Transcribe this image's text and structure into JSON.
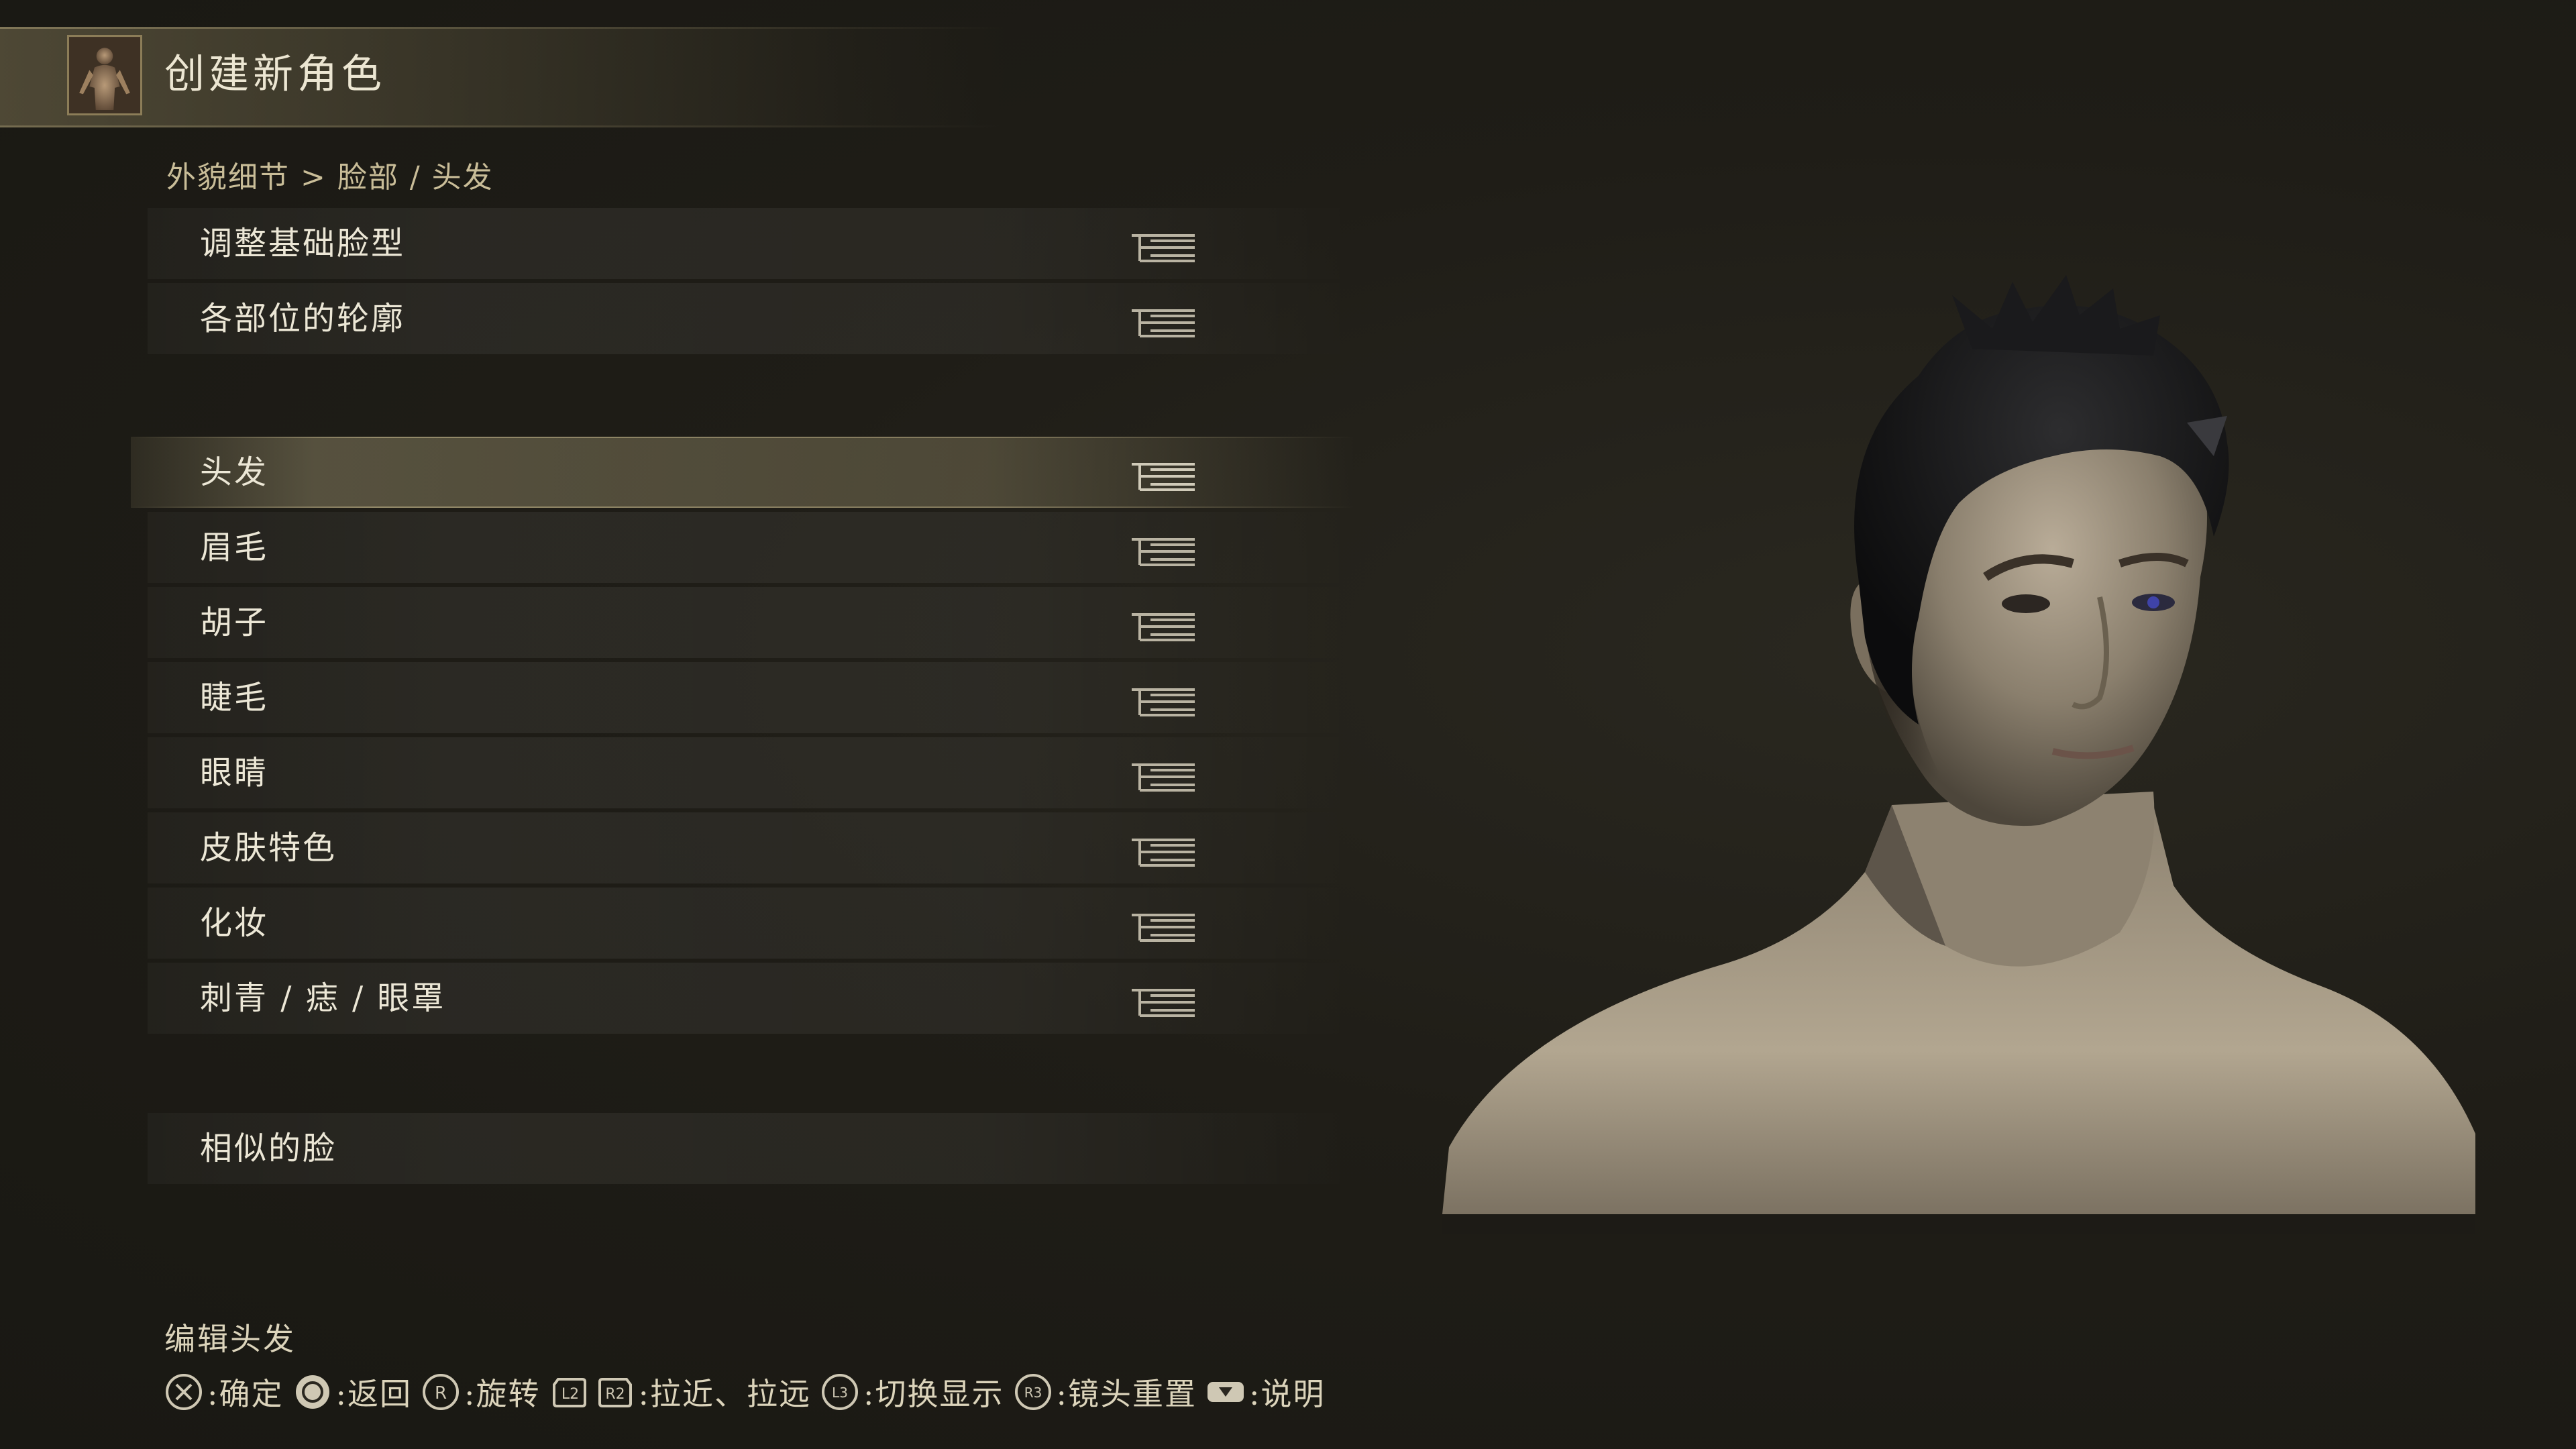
{
  "header": {
    "title": "创建新角色",
    "portrait_icon": "character-body-portrait"
  },
  "breadcrumb": "外貌细节 > 脸部 / 头发",
  "menu": {
    "items": [
      {
        "label": "调整基础脸型",
        "has_submenu": true,
        "selected": false
      },
      {
        "label": "各部位的轮廓",
        "has_submenu": true,
        "selected": false
      },
      {
        "label": "头发",
        "has_submenu": true,
        "selected": true
      },
      {
        "label": "眉毛",
        "has_submenu": true,
        "selected": false
      },
      {
        "label": "胡子",
        "has_submenu": true,
        "selected": false
      },
      {
        "label": "睫毛",
        "has_submenu": true,
        "selected": false
      },
      {
        "label": "眼睛",
        "has_submenu": true,
        "selected": false
      },
      {
        "label": "皮肤特色",
        "has_submenu": true,
        "selected": false
      },
      {
        "label": "化妆",
        "has_submenu": true,
        "selected": false
      },
      {
        "label": "刺青 / 痣 / 眼罩",
        "has_submenu": true,
        "selected": false
      },
      {
        "label": "相似的脸",
        "has_submenu": false,
        "selected": false
      }
    ],
    "submenu_icon": "submenu-list-icon"
  },
  "help_text": "编辑头发",
  "controls": [
    {
      "button": "cross-button",
      "glyph": "✕",
      "label": ":确定"
    },
    {
      "button": "circle-button",
      "glyph": "◯",
      "label": ":返回"
    },
    {
      "button": "r-stick-button",
      "glyph": "R",
      "label": ":旋转"
    },
    {
      "button": "l2-button",
      "glyph": "L2",
      "label": ""
    },
    {
      "button": "r2-button",
      "glyph": "R2",
      "label": ":拉近、拉远"
    },
    {
      "button": "l3-button",
      "glyph": "L3",
      "label": ":切换显示"
    },
    {
      "button": "r3-button",
      "glyph": "R3",
      "label": ":镜头重置"
    },
    {
      "button": "touchpad-button",
      "glyph": "▼",
      "label": ":说明"
    }
  ],
  "colors": {
    "background": "#1f1d17",
    "text": "#ece7d6",
    "accent": "#c9bd98",
    "selected_row": "#a59b76"
  }
}
